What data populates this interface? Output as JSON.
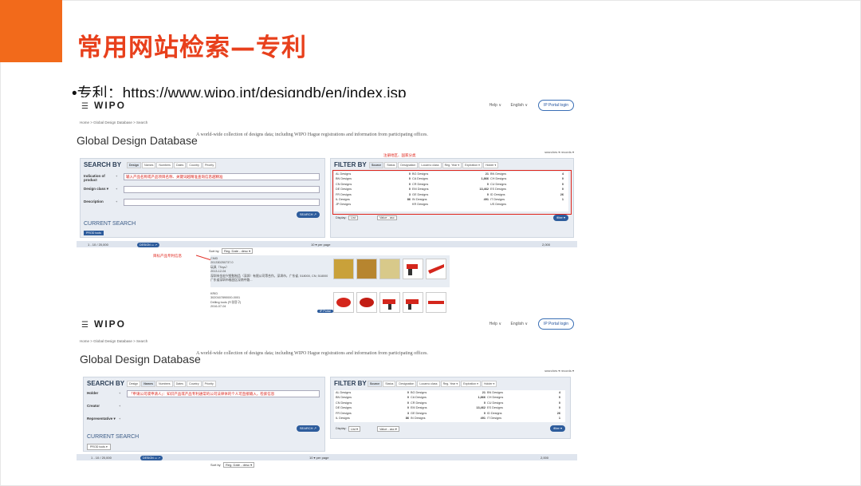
{
  "slide": {
    "title": "常用网站检索—专利",
    "bullet": "•专利：https://www.wipo.int/designdb/en/index.jsp"
  },
  "colors": {
    "accent": "#f26a1b",
    "title": "#e8401c",
    "annotation": "#e0251c",
    "wipo_blue": "#2d5c9c"
  },
  "shot1": {
    "logo": "WIPO",
    "help": "Help ∨",
    "language": "English ∨",
    "portal_login": "IP Portal login",
    "breadcrumb": "Home  >  Global Design Database  >  Search",
    "db_title": "Global Design Database",
    "db_subtitle": "A world-wide collection of designs data; including WIPO Hague registrations and information from participating offices.",
    "counts": "searches ▾  records ▾",
    "search_by": "SEARCH BY",
    "search_tabs": [
      "Design",
      "Names",
      "Numbers",
      "Dates",
      "Country",
      "Priority"
    ],
    "fields": [
      {
        "label": "Indication of product",
        "op": "+",
        "value": "输入产品名称或产品项目名称、关键词越精准查询信息越精准"
      },
      {
        "label": "Design class ▾",
        "op": "+",
        "value": ""
      },
      {
        "label": "Description",
        "op": "+",
        "value": ""
      }
    ],
    "search_button": "SEARCH ↗",
    "current_search": "CURRENT SEARCH",
    "prod_tools": "PROD tools",
    "filter_by": "FILTER BY",
    "filter_tabs": [
      "Source",
      "Status",
      "Designation",
      "Locarno class",
      "Reg. Year ▾",
      "Expiration ▾",
      "Holder ▾"
    ],
    "filter_note": "注册地区、国家分类",
    "filter_cols": [
      [
        [
          "AL Designs",
          "0"
        ],
        [
          "BN Designs",
          "0"
        ],
        [
          "CN Designs",
          "0"
        ],
        [
          "DE Designs",
          "0"
        ],
        [
          "FR Designs",
          "3"
        ],
        [
          "IL Designs",
          "86"
        ],
        [
          "JP Designs",
          ""
        ]
      ],
      [
        [
          "BG Designs",
          "21"
        ],
        [
          "CA Designs",
          "1,866"
        ],
        [
          "CR Designs",
          "0"
        ],
        [
          "EM Designs",
          "13,462"
        ],
        [
          "GE Designs",
          "0"
        ],
        [
          "IN Designs",
          "491"
        ],
        [
          "KR Designs",
          ""
        ]
      ],
      [
        [
          "BN Designs",
          "4"
        ],
        [
          "CH Designs",
          "0"
        ],
        [
          "CU Designs",
          "0"
        ],
        [
          "ES Designs",
          "0"
        ],
        [
          "ID Designs",
          "26"
        ],
        [
          "IT Designs",
          "1"
        ],
        [
          "US Designs",
          ""
        ]
      ]
    ],
    "filter_button": "filter ▾",
    "display_label": "Display:",
    "list_option": "List",
    "sort_option": "Value - asc",
    "results_range": "1 - 10 / 20,000",
    "design_pill": "DESIGN ▭ ↗",
    "per_page": "10 ▾  per page",
    "pages": "2,000",
    "sort_by_label": "Sort by",
    "sort_by_value": "Reg. Date - desc ▾",
    "result_note": "目标产品专利信息",
    "result1": {
      "office": "CNID",
      "number": "201330250737.0",
      "name": "玩具（Toys）",
      "date": "2013-12-04",
      "holder": "深圳市金宏兴塑胶制品（深圳）有限公司等合作，深圳市，广东省, 518000, CN; 518000 广东省深圳市福田区深南中路..."
    },
    "result2": {
      "office": "KRID",
      "number": "3020167890000-0001",
      "name": "Drilling tools (드릴용구)",
      "date": "2016-07-04"
    },
    "ip_portal_tag": "IP Portal"
  },
  "shot2": {
    "logo": "WIPO",
    "help": "Help ∨",
    "language": "English ∨",
    "portal_login": "IP Portal login",
    "breadcrumb": "Home  >  Global Design Database  >  Search",
    "db_title": "Global Design Database",
    "db_subtitle": "A world-wide collection of designs data; including WIPO Hague registrations and information from participating offices.",
    "counts": "searches ▾  records ▾",
    "search_by": "SEARCH BY",
    "search_tabs": [
      "Design",
      "Names",
      "Numbers",
      "Dates",
      "Country",
      "Priority"
    ],
    "fields": [
      {
        "label": "Holder",
        "op": "+",
        "value": "「申请公司或申请人」：知识产品或产品专利通常的公司法律体的个人可直接输入，检索信息"
      },
      {
        "label": "Creator",
        "op": "+",
        "value": ""
      },
      {
        "label": "Representative ▾",
        "op": "+",
        "value": ""
      }
    ],
    "search_button": "SEARCH ↗",
    "current_search": "CURRENT SEARCH",
    "prod_tools": "PROD tools ▾",
    "filter_by": "FILTER BY",
    "filter_tabs": [
      "Source",
      "Status",
      "Designation",
      "Locarno class",
      "Reg. Year ▾",
      "Expiration ▾",
      "Holder ▾"
    ],
    "filter_cols": [
      [
        [
          "AL Designs",
          "0"
        ],
        [
          "BN Designs",
          "0"
        ],
        [
          "CN Designs",
          "0"
        ],
        [
          "DE Designs",
          "0"
        ],
        [
          "FR Designs",
          "3"
        ],
        [
          "IL Designs",
          "86"
        ]
      ],
      [
        [
          "BG Designs",
          "21"
        ],
        [
          "CA Designs",
          "1,866"
        ],
        [
          "CR Designs",
          "0"
        ],
        [
          "EM Designs",
          "13,462"
        ],
        [
          "GE Designs",
          "0"
        ],
        [
          "IN Designs",
          "491"
        ]
      ],
      [
        [
          "BN Designs",
          "4"
        ],
        [
          "CH Designs",
          "0"
        ],
        [
          "CU Designs",
          "0"
        ],
        [
          "ES Designs",
          "0"
        ],
        [
          "ID Designs",
          "26"
        ],
        [
          "IT Designs",
          "1"
        ]
      ]
    ],
    "filter_button": "filter ▾",
    "display_label": "Display:",
    "list_option": "List ▾",
    "sort_option": "Value - asc ▾",
    "results_range": "1 - 10 / 20,000",
    "design_pill": "DESIGN ▭ ↗",
    "per_page": "10 ▾  per page",
    "pages": "2,000",
    "sort_by_label": "Sort by",
    "sort_by_value": "Reg. Date - desc ▾"
  }
}
